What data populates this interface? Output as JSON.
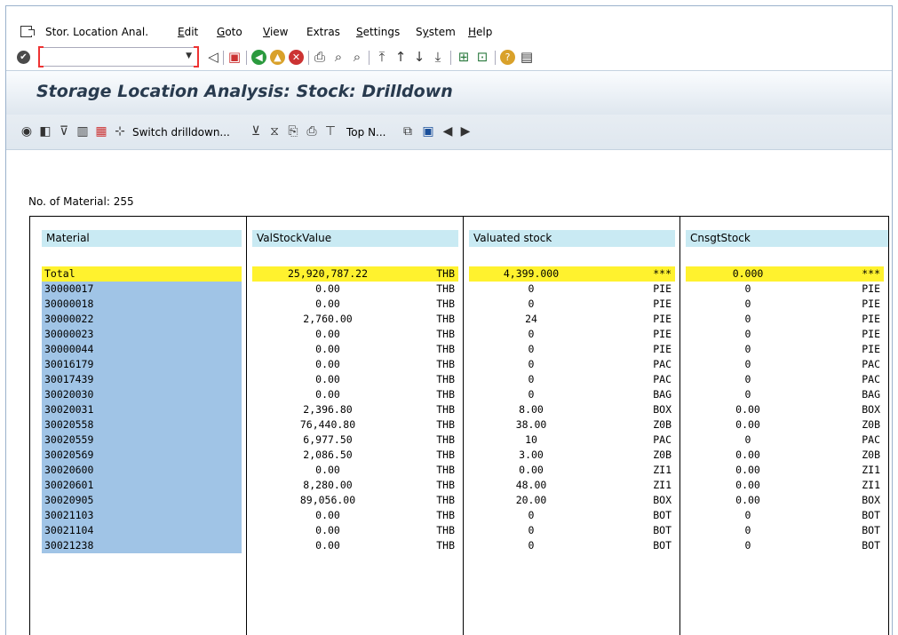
{
  "menu": {
    "items": [
      {
        "label": "Stor. Location Anal.",
        "u": ""
      },
      {
        "label": "Edit",
        "u": "E"
      },
      {
        "label": "Goto",
        "u": "G"
      },
      {
        "label": "View",
        "u": "V"
      },
      {
        "label": "Extras",
        "u": ""
      },
      {
        "label": "Settings",
        "u": "S"
      },
      {
        "label": "System",
        "u": "y"
      },
      {
        "label": "Help",
        "u": "H"
      }
    ]
  },
  "command_field": {
    "value": ""
  },
  "title": "Storage Location Analysis: Stock: Drilldown",
  "app_toolbar": {
    "switch_drilldown": "Switch drilldown...",
    "top_n": "Top N..."
  },
  "count_line": "No. of Material: 255",
  "columns": {
    "material": "Material",
    "valstockvalue": "ValStockValue",
    "valuated": "Valuated stock",
    "cnsgt": "CnsgtStock"
  },
  "total_row": {
    "label": "Total",
    "value": "25,920,787.22",
    "currency": "THB",
    "valuated": "4,399.000",
    "valuated_unit": "***",
    "cnsgt": "0.000",
    "cnsgt_unit": "***"
  },
  "rows": [
    {
      "material": "30000017",
      "value": "0.00",
      "currency": "THB",
      "valuated": "0",
      "vu": "PIE",
      "cnsgt": "0",
      "cu": "PIE"
    },
    {
      "material": "30000018",
      "value": "0.00",
      "currency": "THB",
      "valuated": "0",
      "vu": "PIE",
      "cnsgt": "0",
      "cu": "PIE"
    },
    {
      "material": "30000022",
      "value": "2,760.00",
      "currency": "THB",
      "valuated": "24",
      "vu": "PIE",
      "cnsgt": "0",
      "cu": "PIE"
    },
    {
      "material": "30000023",
      "value": "0.00",
      "currency": "THB",
      "valuated": "0",
      "vu": "PIE",
      "cnsgt": "0",
      "cu": "PIE"
    },
    {
      "material": "30000044",
      "value": "0.00",
      "currency": "THB",
      "valuated": "0",
      "vu": "PIE",
      "cnsgt": "0",
      "cu": "PIE"
    },
    {
      "material": "30016179",
      "value": "0.00",
      "currency": "THB",
      "valuated": "0",
      "vu": "PAC",
      "cnsgt": "0",
      "cu": "PAC"
    },
    {
      "material": "30017439",
      "value": "0.00",
      "currency": "THB",
      "valuated": "0",
      "vu": "PAC",
      "cnsgt": "0",
      "cu": "PAC"
    },
    {
      "material": "30020030",
      "value": "0.00",
      "currency": "THB",
      "valuated": "0",
      "vu": "BAG",
      "cnsgt": "0",
      "cu": "BAG"
    },
    {
      "material": "30020031",
      "value": "2,396.80",
      "currency": "THB",
      "valuated": "8.00",
      "vu": "BOX",
      "cnsgt": "0.00",
      "cu": "BOX"
    },
    {
      "material": "30020558",
      "value": "76,440.80",
      "currency": "THB",
      "valuated": "38.00",
      "vu": "Z0B",
      "cnsgt": "0.00",
      "cu": "Z0B"
    },
    {
      "material": "30020559",
      "value": "6,977.50",
      "currency": "THB",
      "valuated": "10",
      "vu": "PAC",
      "cnsgt": "0",
      "cu": "PAC"
    },
    {
      "material": "30020569",
      "value": "2,086.50",
      "currency": "THB",
      "valuated": "3.00",
      "vu": "Z0B",
      "cnsgt": "0.00",
      "cu": "Z0B"
    },
    {
      "material": "30020600",
      "value": "0.00",
      "currency": "THB",
      "valuated": "0.00",
      "vu": "ZI1",
      "cnsgt": "0.00",
      "cu": "ZI1"
    },
    {
      "material": "30020601",
      "value": "8,280.00",
      "currency": "THB",
      "valuated": "48.00",
      "vu": "ZI1",
      "cnsgt": "0.00",
      "cu": "ZI1"
    },
    {
      "material": "30020905",
      "value": "89,056.00",
      "currency": "THB",
      "valuated": "20.00",
      "vu": "BOX",
      "cnsgt": "0.00",
      "cu": "BOX"
    },
    {
      "material": "30021103",
      "value": "0.00",
      "currency": "THB",
      "valuated": "0",
      "vu": "BOT",
      "cnsgt": "0",
      "cu": "BOT"
    },
    {
      "material": "30021104",
      "value": "0.00",
      "currency": "THB",
      "valuated": "0",
      "vu": "BOT",
      "cnsgt": "0",
      "cu": "BOT"
    },
    {
      "material": "30021238",
      "value": "0.00",
      "currency": "THB",
      "valuated": "0",
      "vu": "BOT",
      "cnsgt": "0",
      "cu": "BOT"
    }
  ]
}
